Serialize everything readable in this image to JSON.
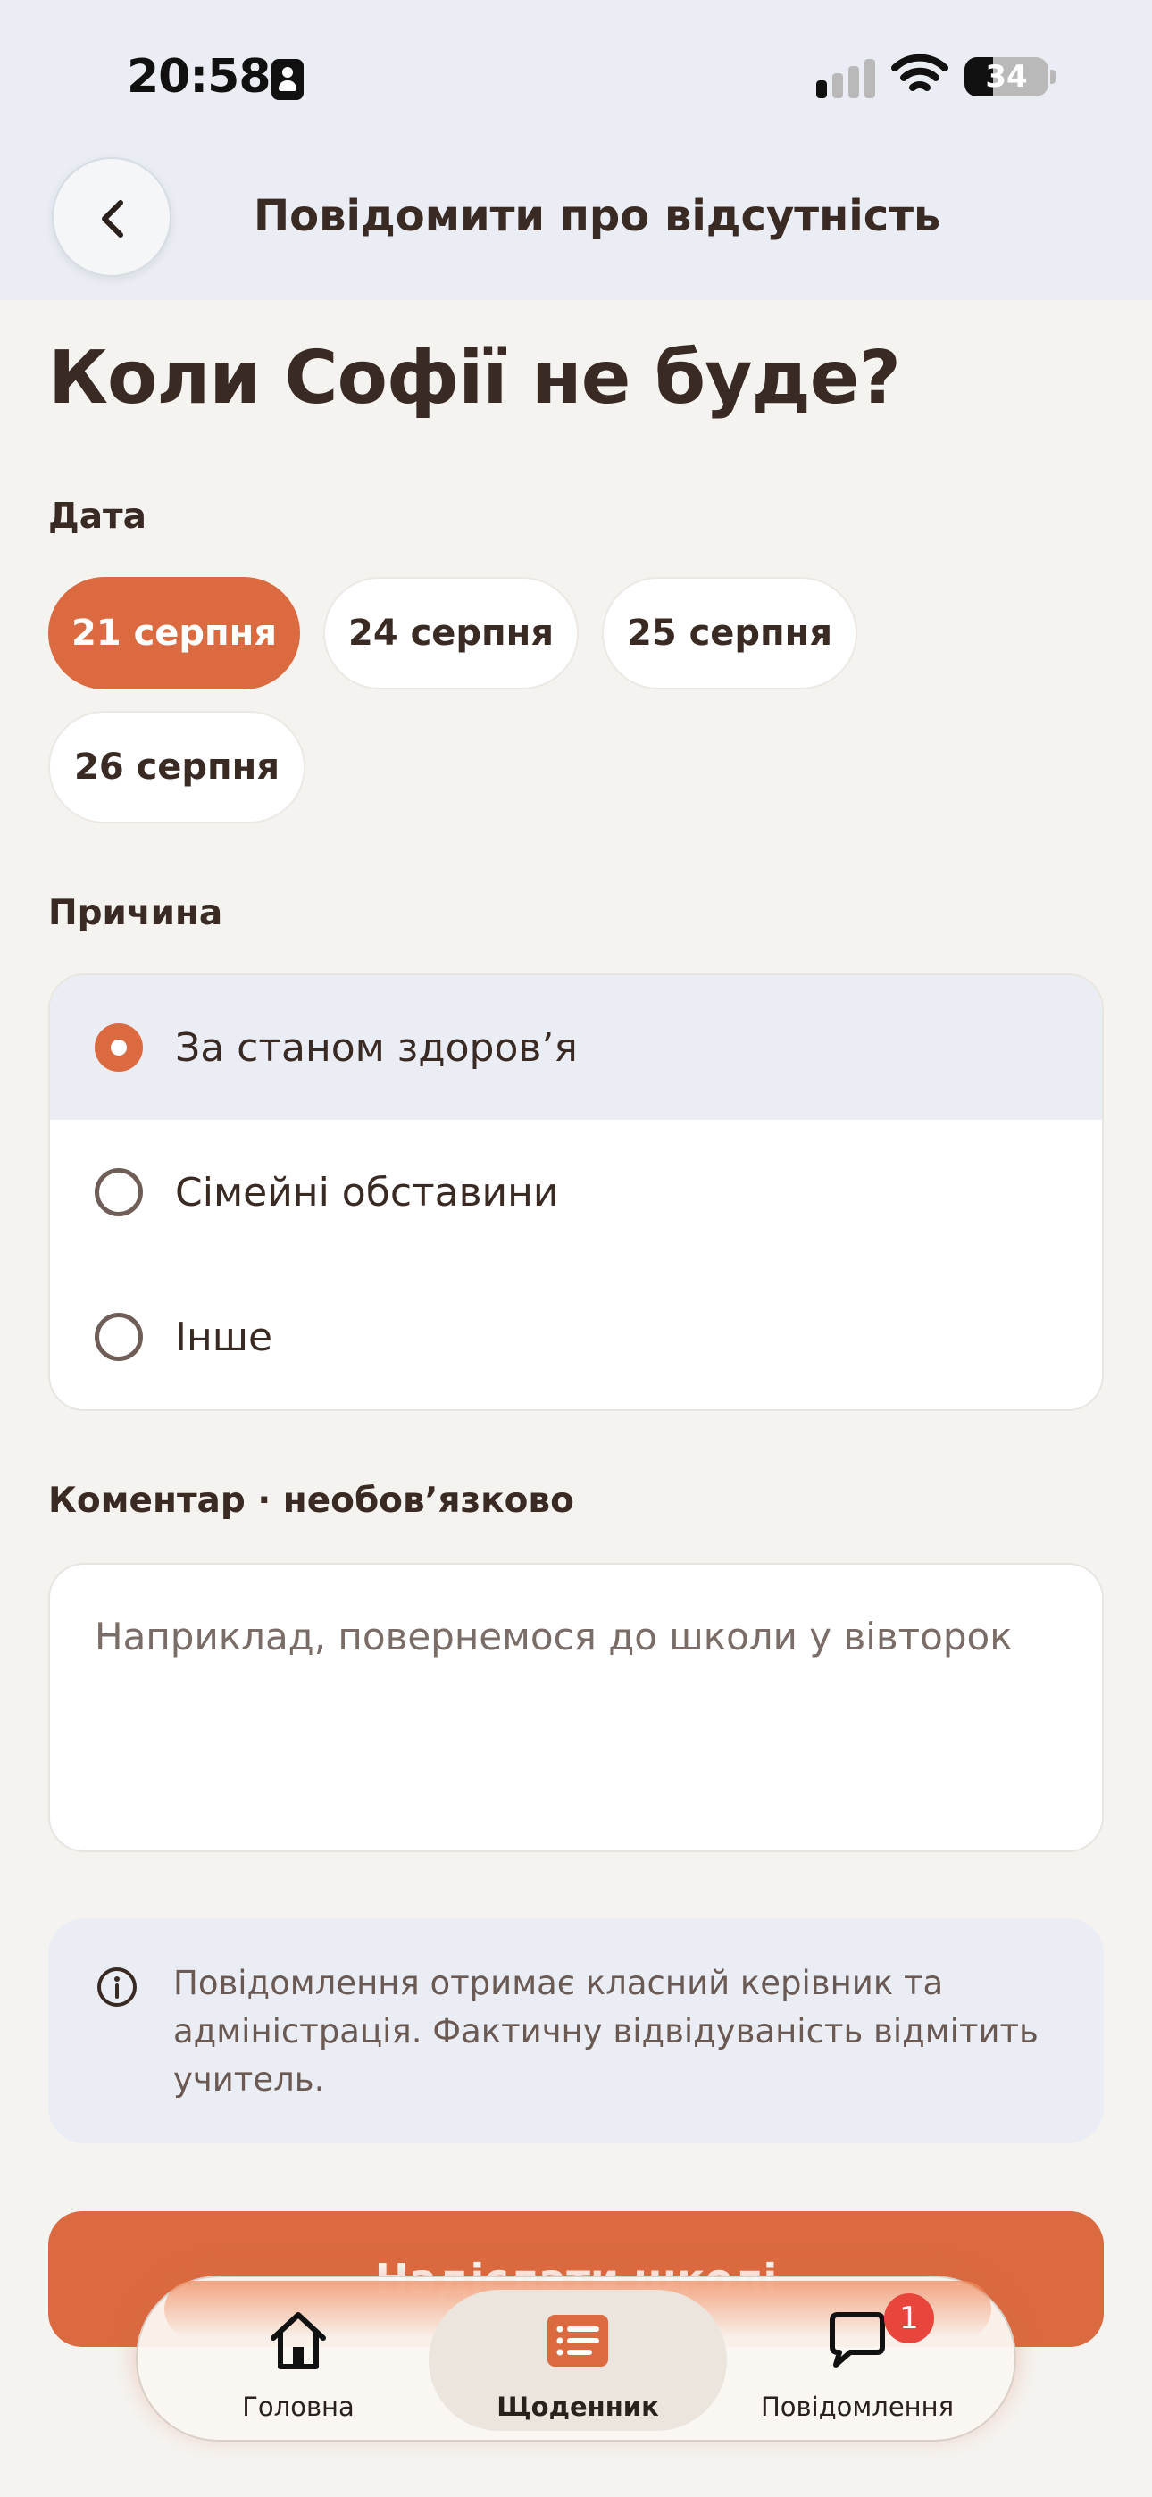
{
  "status_bar": {
    "time": "20:58",
    "battery_level": "34",
    "signal_bars_active": 1,
    "signal_bars_total": 4
  },
  "header": {
    "title": "Повідомити про відсутність"
  },
  "page_title": "Коли Софії не буде?",
  "date_section": {
    "label": "Дата",
    "chips": [
      "21 серпня",
      "24 серпня",
      "25 серпня",
      "26 серпня"
    ],
    "selected_index": 0
  },
  "reason_section": {
    "label": "Причина",
    "options": [
      "За станом здоров’я",
      "Сімейні обставини",
      "Інше"
    ],
    "selected_index": 0
  },
  "comment_section": {
    "label": "Коментар · необов’язково",
    "value": "",
    "placeholder": "Наприклад, повернемося до школи у вівторок"
  },
  "info": {
    "text": "Повідомлення отримає класний керівник та адміністрація. Фактичну відвідуваність відмітить учитель."
  },
  "submit_label": "Надіслати школі",
  "tab_bar": {
    "items": [
      {
        "label": "Головна",
        "icon": "home-icon"
      },
      {
        "label": "Щоденник",
        "icon": "diary-icon"
      },
      {
        "label": "Повідомлення",
        "icon": "chat-icon"
      }
    ],
    "active_index": 1,
    "messages_badge": "1"
  },
  "colors": {
    "accent": "#db6a40",
    "background": "#f5f3f0",
    "header_bg": "#eaeef4",
    "text": "#3a2a24",
    "badge": "#e8453c"
  }
}
